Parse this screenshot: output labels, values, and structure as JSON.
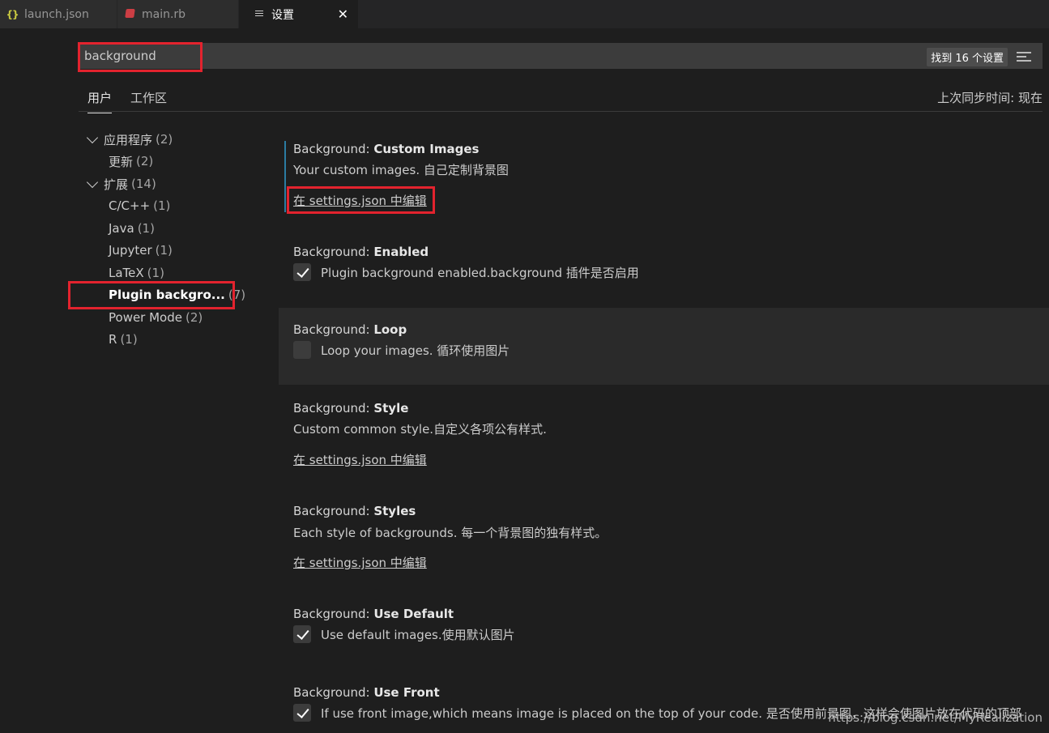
{
  "tabs": [
    {
      "label": "launch.json",
      "icon": "json-braces-icon"
    },
    {
      "label": "main.rb",
      "icon": "ruby-icon"
    },
    {
      "label": "设置",
      "icon": "settings-menu-icon",
      "close": "✕"
    }
  ],
  "search": {
    "value": "background",
    "count": "找到 16 个设置"
  },
  "scope": {
    "user": "用户",
    "workspace": "工作区",
    "sync": "上次同步时间: 现在"
  },
  "toc": [
    {
      "label": "应用程序",
      "count": "(2)",
      "expanded": true
    },
    {
      "label": "更新",
      "count": "(2)"
    },
    {
      "label": "扩展",
      "count": "(14)",
      "expanded": true
    },
    {
      "label": "C/C++",
      "count": "(1)"
    },
    {
      "label": "Java",
      "count": "(1)"
    },
    {
      "label": "Jupyter",
      "count": "(1)"
    },
    {
      "label": "LaTeX",
      "count": "(1)"
    },
    {
      "label": "Plugin backgro...",
      "count": "(7)",
      "active": true
    },
    {
      "label": "Power Mode",
      "count": "(2)"
    },
    {
      "label": "R",
      "count": "(1)"
    }
  ],
  "settings": [
    {
      "category": "Background: ",
      "key": "Custom Images",
      "desc": "Your custom images. 自己定制背景图",
      "link": "在 settings.json 中编辑"
    },
    {
      "category": "Background: ",
      "key": "Enabled",
      "check_label": "Plugin background enabled.background 插件是否启用",
      "checked": true
    },
    {
      "category": "Background: ",
      "key": "Loop",
      "check_label": "Loop your images. 循环使用图片",
      "checked": false
    },
    {
      "category": "Background: ",
      "key": "Style",
      "desc": "Custom common style.自定义各项公有样式.",
      "link": "在 settings.json 中编辑"
    },
    {
      "category": "Background: ",
      "key": "Styles",
      "desc": "Each style of backgrounds. 每一个背景图的独有样式。",
      "link": "在 settings.json 中编辑"
    },
    {
      "category": "Background: ",
      "key": "Use Default",
      "check_label": "Use default images.使用默认图片",
      "checked": true
    },
    {
      "category": "Background: ",
      "key": "Use Front",
      "check_label": "If use front image,which means image is placed on the top of your code. 是否使用前景图，这样会使图片放在代码的顶部",
      "checked": true
    }
  ],
  "watermark": "https://blog.csdn.net/MyRealization",
  "colors": {
    "highlight_red": "#e3232e",
    "background": "#1e1e1e",
    "focus": "#2b7ca3"
  }
}
